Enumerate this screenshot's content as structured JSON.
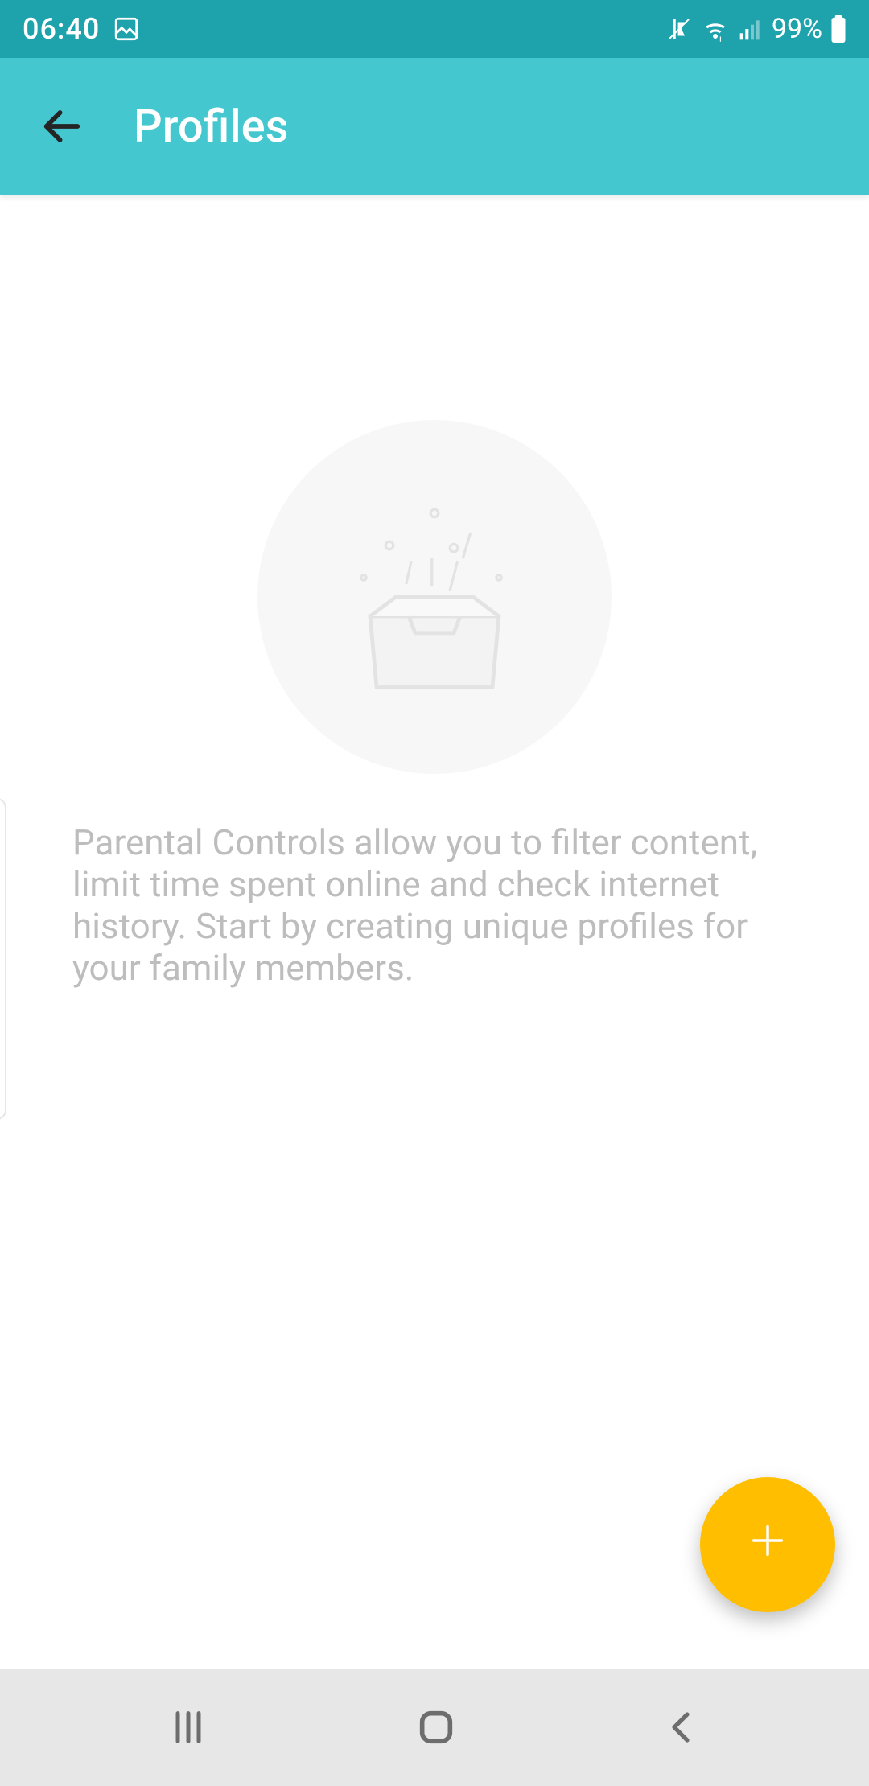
{
  "status": {
    "time": "06:40",
    "battery": "99%"
  },
  "appbar": {
    "title": "Profiles"
  },
  "empty": {
    "description": "Parental Controls allow you to filter content, limit time spent online and check internet history. Start by creating unique profiles for your family members."
  },
  "fab": {
    "label": "+"
  }
}
